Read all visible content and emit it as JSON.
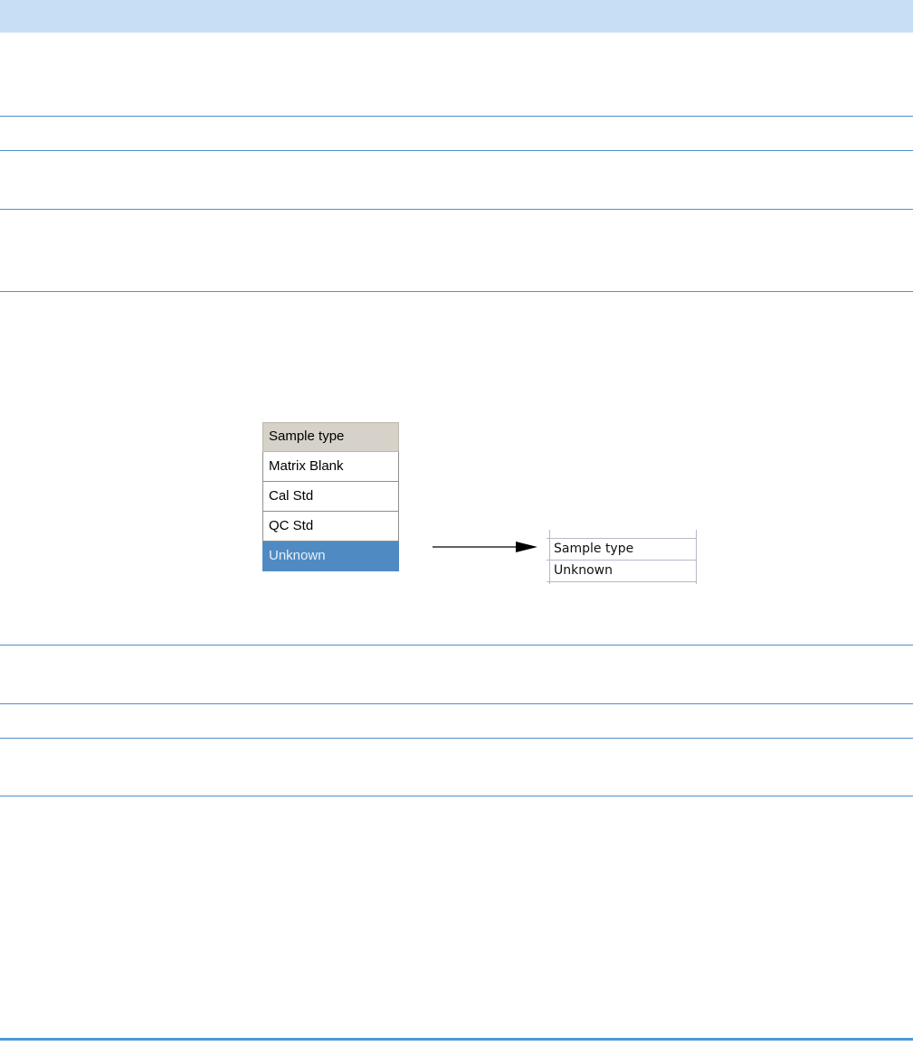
{
  "dropdown": {
    "header": "Sample type",
    "options": [
      "Matrix Blank",
      "Cal Std",
      "QC Std",
      "Unknown"
    ],
    "selected": "Unknown"
  },
  "result_sheet": {
    "header": "Sample type",
    "value": "Unknown"
  },
  "colors": {
    "header_band": "#c7dff5",
    "rule": "#4f8fd0",
    "selected_bg": "#4f8bc2"
  }
}
